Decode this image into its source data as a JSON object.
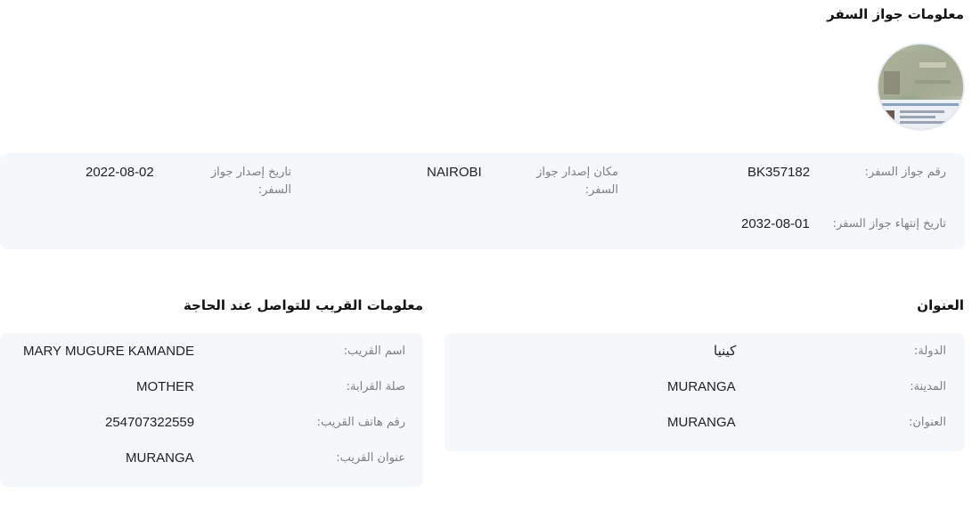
{
  "passport": {
    "section_title": "معلومات جواز السفر",
    "photo_icon": "passport-photo",
    "number_label": "رقم جواز السفر:",
    "number_value": "BK357182",
    "issue_place_label_l1": "مكان إصدار جواز",
    "issue_place_label_l2": "السفر:",
    "issue_place_value": "NAIROBI",
    "issue_date_label_l1": "تاريخ إصدار جواز",
    "issue_date_label_l2": "السفر:",
    "issue_date_value": "2022-08-02",
    "expiry_label": "تاريخ إنتهاء جواز السفر:",
    "expiry_value": "2032-08-01"
  },
  "address": {
    "section_title": "العنوان",
    "country_label": "الدولة:",
    "country_value": "كينيا",
    "city_label": "المدينة:",
    "city_value": "MURANGA",
    "address_label": "العنوان:",
    "address_value": "MURANGA"
  },
  "relative": {
    "section_title": "معلومات القريب للتواصل عند الحاجة",
    "name_label": "اسم القريب:",
    "name_value": "MARY MUGURE KAMANDE",
    "relation_label": "صلة القرابة:",
    "relation_value": "MOTHER",
    "phone_label": "رقم هاتف القريب:",
    "phone_value": "254707322559",
    "address_label": "عنوان القريب:",
    "address_value": "MURANGA"
  }
}
